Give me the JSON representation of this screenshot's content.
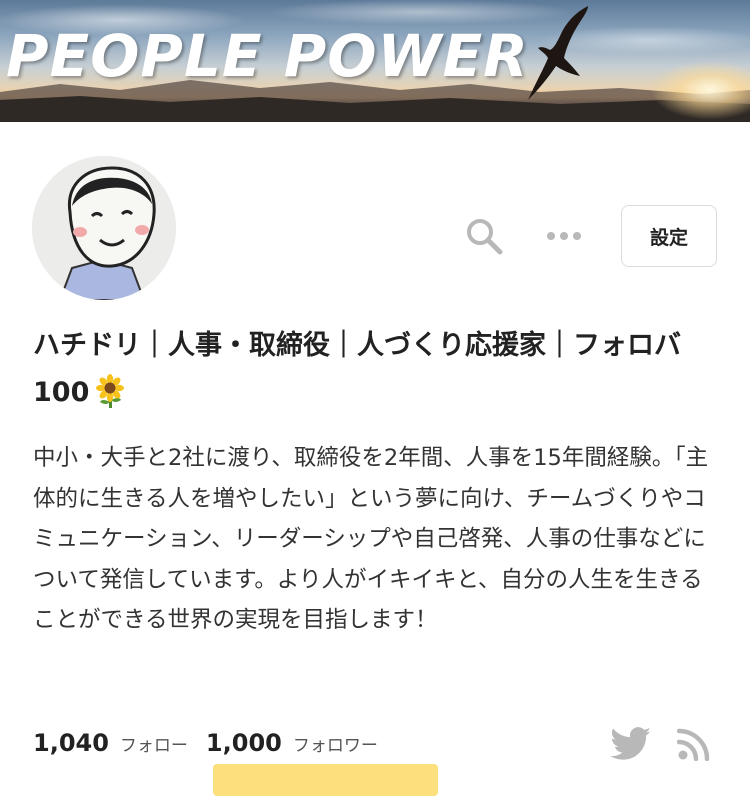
{
  "banner": {
    "title": "PEOPLE POWER",
    "bird_icon": "eagle-silhouette"
  },
  "profile": {
    "name": "ハチドリ｜人事・取締役｜人づくり応援家｜フォロバ100",
    "name_emoji_icon": "sunflower-icon",
    "bio": "中小・大手と2社に渡り、取締役を2年間、人事を15年間経験。「主体的に生きる人を増やしたい」という夢に向け、チームづくりやコミュニケーション、リーダーシップや自己啓発、人事の仕事などについて発信しています。より人がイキイキと、自分の人生を生きることができる世界の実現を目指します！"
  },
  "actions": {
    "search_icon": "search-icon",
    "more_icon": "more-icon",
    "settings_label": "設定"
  },
  "stats": {
    "following_count": "1,040",
    "following_label": "フォロー",
    "followers_count": "1,000",
    "followers_label": "フォロワー"
  },
  "social": {
    "twitter_icon": "twitter-icon",
    "rss_icon": "rss-icon"
  },
  "colors": {
    "highlight": "#fde07e",
    "icon_gray": "#b8b8b8",
    "text": "#222222"
  }
}
